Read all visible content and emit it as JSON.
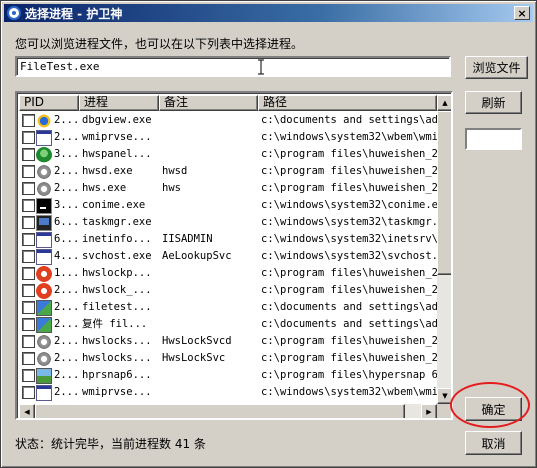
{
  "window": {
    "title": "选择进程 - 护卫神",
    "close_label": "×"
  },
  "prompt": "您可以浏览进程文件，也可以在以下列表中选择进程。",
  "path_input": {
    "value": "FileTest.exe"
  },
  "buttons": {
    "browse": "浏览文件",
    "refresh": "刷新",
    "ok": "确定",
    "cancel": "取消"
  },
  "table": {
    "columns": [
      "PID",
      "进程",
      "备注",
      "路径"
    ],
    "rows": [
      {
        "icon": "star-icon",
        "pid": "2...",
        "name": "dbgview.exe",
        "note": "",
        "path": "c:\\documents and settings\\ad..."
      },
      {
        "icon": "window-icon",
        "pid": "2...",
        "name": "wmiprvse...",
        "note": "",
        "path": "c:\\windows\\system32\\wbem\\wmi..."
      },
      {
        "icon": "shield-icon",
        "pid": "3...",
        "name": "hwspanel...",
        "note": "",
        "path": "c:\\program files\\huweishen_2..."
      },
      {
        "icon": "gear-icon",
        "pid": "2...",
        "name": "hwsd.exe",
        "note": "hwsd",
        "path": "c:\\program files\\huweishen_2..."
      },
      {
        "icon": "gear-icon",
        "pid": "2...",
        "name": "hws.exe",
        "note": "hws",
        "path": "c:\\program files\\huweishen_2..."
      },
      {
        "icon": "console-icon",
        "pid": "3...",
        "name": "conime.exe",
        "note": "",
        "path": "c:\\windows\\system32\\conime.e..."
      },
      {
        "icon": "monitor-icon",
        "pid": "6...",
        "name": "taskmgr.exe",
        "note": "",
        "path": "c:\\windows\\system32\\taskmgr.e..."
      },
      {
        "icon": "window-icon",
        "pid": "6...",
        "name": "inetinfo...",
        "note": "IISADMIN",
        "path": "c:\\windows\\system32\\inetsrv\\..."
      },
      {
        "icon": "window-icon",
        "pid": "4...",
        "name": "svchost.exe",
        "note": "AeLookupSvc",
        "path": "c:\\windows\\system32\\svchost.e..."
      },
      {
        "icon": "lock-icon",
        "pid": "1...",
        "name": "hwslockp...",
        "note": "",
        "path": "c:\\program files\\huweishen_2..."
      },
      {
        "icon": "lock-icon",
        "pid": "2...",
        "name": "hwslock_...",
        "note": "",
        "path": "c:\\program files\\huweishen_2..."
      },
      {
        "icon": "app-icon",
        "pid": "2...",
        "name": "filetest...",
        "note": "",
        "path": "c:\\documents and settings\\ad..."
      },
      {
        "icon": "app-icon",
        "pid": "2...",
        "name": "复件 fil...",
        "note": "",
        "path": "c:\\documents and settings\\ad..."
      },
      {
        "icon": "gear-icon",
        "pid": "2...",
        "name": "hwslocks...",
        "note": "HwsLockSvcd",
        "path": "c:\\program files\\huweishen_2..."
      },
      {
        "icon": "gear-icon",
        "pid": "2...",
        "name": "hwslocks...",
        "note": "HwsLockSvc",
        "path": "c:\\program files\\huweishen_2..."
      },
      {
        "icon": "photo-icon",
        "pid": "2...",
        "name": "hprsnap6...",
        "note": "",
        "path": "c:\\program files\\hypersnap 6..."
      },
      {
        "icon": "window-icon",
        "pid": "2...",
        "name": "wmiprvse...",
        "note": "",
        "path": "c:\\windows\\system32\\wbem\\wmi..."
      }
    ]
  },
  "scrollbar": {
    "up": "▲",
    "down": "▼",
    "left": "◀",
    "right": "▶"
  },
  "status": "状态：统计完毕，当前进程数 41 条",
  "colors": {
    "titlebar": "#0a246a",
    "face": "#d4d0c8",
    "highlight_ring": "#e51c1c"
  }
}
